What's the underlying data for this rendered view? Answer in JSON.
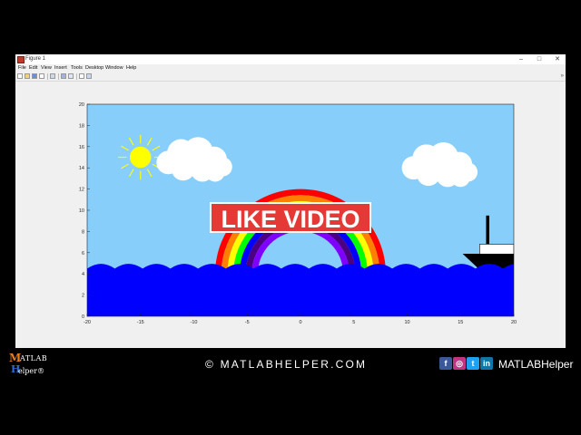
{
  "window": {
    "title": "Figure 1",
    "controls": {
      "minimize": "–",
      "maximize": "□",
      "close": "✕"
    },
    "menu": [
      "File",
      "Edit",
      "View",
      "Insert",
      "Tools",
      "Desktop",
      "Window",
      "Help"
    ]
  },
  "toolbar": {
    "icons": [
      "new-figure-icon",
      "open-icon",
      "save-icon",
      "print-icon",
      "link-plot-icon",
      "insert-colorbar-icon",
      "insert-legend-icon",
      "pointer-icon",
      "property-editor-icon"
    ],
    "more_glyph": "»"
  },
  "overlay": {
    "text": "LIKE VIDEO",
    "color": "#e53935"
  },
  "footer": {
    "logo": {
      "m": "M",
      "atlab": "ATLAB",
      "h": "H",
      "elper": "elper®"
    },
    "copyright": "© MATLABHELPER.COM",
    "social_icons": [
      {
        "name": "facebook-icon",
        "glyph": "f",
        "color": "#3b5998"
      },
      {
        "name": "instagram-icon",
        "glyph": "◎",
        "color": "#c13584"
      },
      {
        "name": "twitter-icon",
        "glyph": "t",
        "color": "#1da1f2"
      },
      {
        "name": "linkedin-icon",
        "glyph": "in",
        "color": "#0e76a8"
      }
    ],
    "handle": "MATLABHelper"
  },
  "chart_data": {
    "type": "scatter",
    "title": "",
    "xlabel": "",
    "ylabel": "",
    "xlim": [
      -20,
      20
    ],
    "ylim": [
      0,
      20
    ],
    "xticks": [
      -20,
      -15,
      -10,
      -5,
      0,
      5,
      10,
      15,
      20
    ],
    "yticks": [
      0,
      2,
      4,
      6,
      8,
      10,
      12,
      14,
      16,
      18,
      20
    ],
    "grid": false,
    "colors": {
      "sky": "#87cefa",
      "sea": "#0000ff",
      "sun": "#ffff00",
      "cloud": "#ffffff",
      "ship": "#000000",
      "rainbow": [
        "#ff0000",
        "#ff8000",
        "#ffff00",
        "#00ff00",
        "#0000ff",
        "#4b0082",
        "#8000ff"
      ]
    },
    "scene": {
      "sun": {
        "center": [
          -15,
          15
        ],
        "radius": 1
      },
      "clouds": [
        {
          "center": [
            -10,
            14.5
          ]
        },
        {
          "center": [
            13,
            14
          ]
        }
      ],
      "rainbow": {
        "center": [
          0,
          4
        ],
        "outer_radius": 8,
        "bands": 7
      },
      "sea_level": 4.5,
      "ship": {
        "x": [
          17,
          20
        ],
        "y": [
          4,
          9.5
        ]
      }
    }
  }
}
